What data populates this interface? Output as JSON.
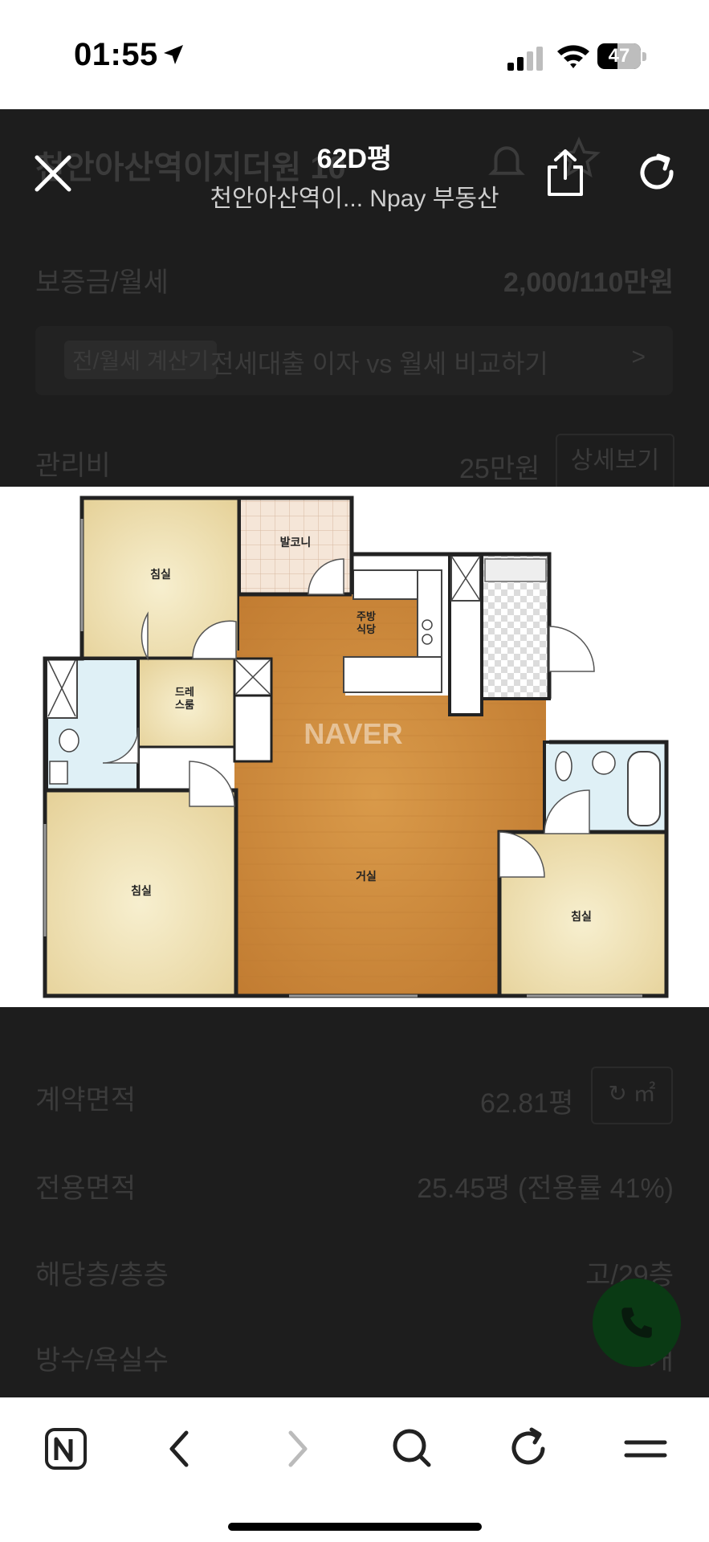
{
  "status_bar": {
    "time": "01:55",
    "battery": "47",
    "battery_level": 0.47
  },
  "header": {
    "title": "62D평",
    "subtitle": "천안아산역이...  Npay 부동산"
  },
  "background_page": {
    "listing_title": "천안아산역이지더원 10",
    "deposit_label": "보증금/월세",
    "deposit_value": "2,000/110만원",
    "calc_tag": "전/월세 계산기",
    "calc_text": "전세대출 이자 vs 월세 비교하기",
    "calc_chevron": ">",
    "mgmt_label": "관리비",
    "mgmt_value": "25만원",
    "detail_button": "상세보기",
    "contract_area_label": "계약면적",
    "contract_area_value": "62.81평",
    "unit_toggle": "㎡",
    "exclusive_area_label": "전용면적",
    "exclusive_area_value": "25.45평 (전용률 41%)",
    "floor_label": "해당층/총층",
    "floor_value": "고/29층",
    "rooms_label": "방수/욕실수",
    "rooms_value": "개"
  },
  "floor_plan": {
    "watermark": "NAVER",
    "rooms": {
      "bedroom_top": "침실",
      "balcony": "발코니",
      "kitchen_line1": "주방",
      "kitchen_line2": "식당",
      "dress_line1": "드레",
      "dress_line2": "스룸",
      "bedroom_left": "침실",
      "living": "거실",
      "bedroom_right": "침실"
    }
  },
  "colors": {
    "overlay": "#1d1d1d",
    "floor_wood": "#c98a3a",
    "room_beige": "#efe0a8"
  }
}
